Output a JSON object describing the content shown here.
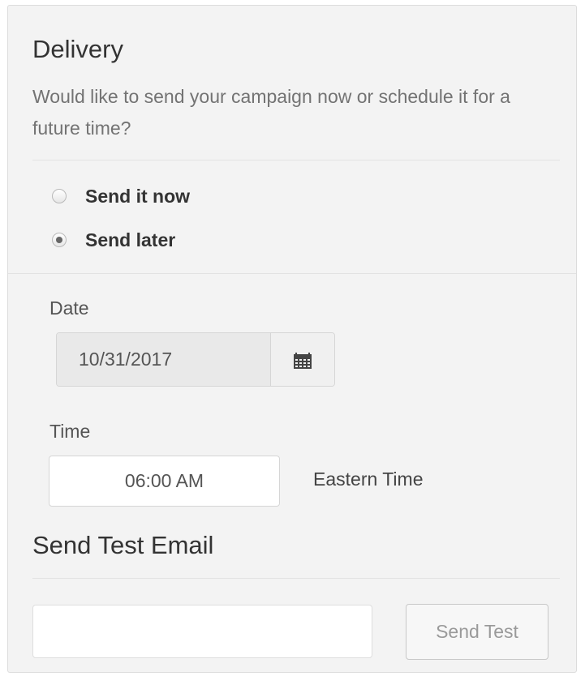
{
  "delivery": {
    "title": "Delivery",
    "description": "Would like to send your campaign now or schedule it for a future time?",
    "options": [
      {
        "label": "Send it now",
        "checked": false
      },
      {
        "label": "Send later",
        "checked": true
      }
    ]
  },
  "schedule": {
    "date_label": "Date",
    "date_value": "10/31/2017",
    "calendar_icon": "calendar-icon",
    "time_label": "Time",
    "time_value": "06:00 AM",
    "timezone": "Eastern Time"
  },
  "test_email": {
    "title": "Send Test Email",
    "email_value": "",
    "button_label": "Send Test"
  }
}
